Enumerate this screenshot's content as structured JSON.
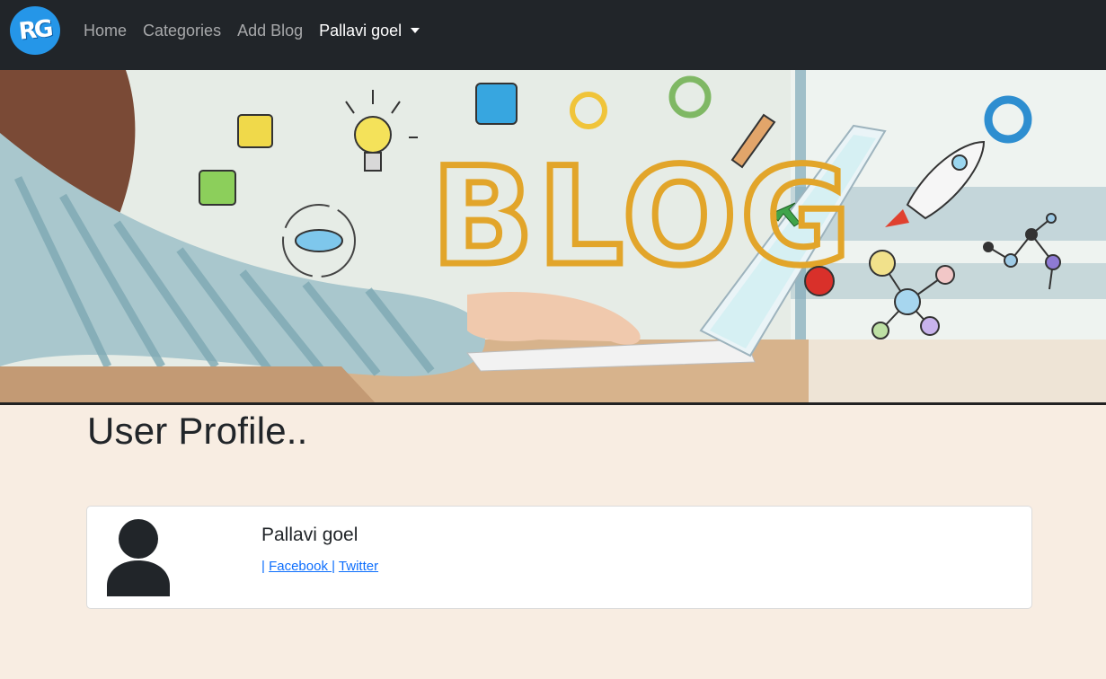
{
  "navbar": {
    "logo_text": "RG",
    "items": [
      {
        "label": "Home"
      },
      {
        "label": "Categories"
      },
      {
        "label": "Add Blog"
      }
    ],
    "user_menu_label": "Pallavi goel"
  },
  "banner": {
    "word": "BLOG"
  },
  "page": {
    "title": "User Profile.."
  },
  "profile": {
    "name": "Pallavi goel",
    "sep1": "| ",
    "facebook": "Facebook ",
    "sep2": "| ",
    "twitter": "Twitter"
  },
  "colors": {
    "navbar_bg": "#212529",
    "page_bg": "#f8ede2",
    "link": "#0d6efd",
    "logo_bg": "#2596e8"
  }
}
